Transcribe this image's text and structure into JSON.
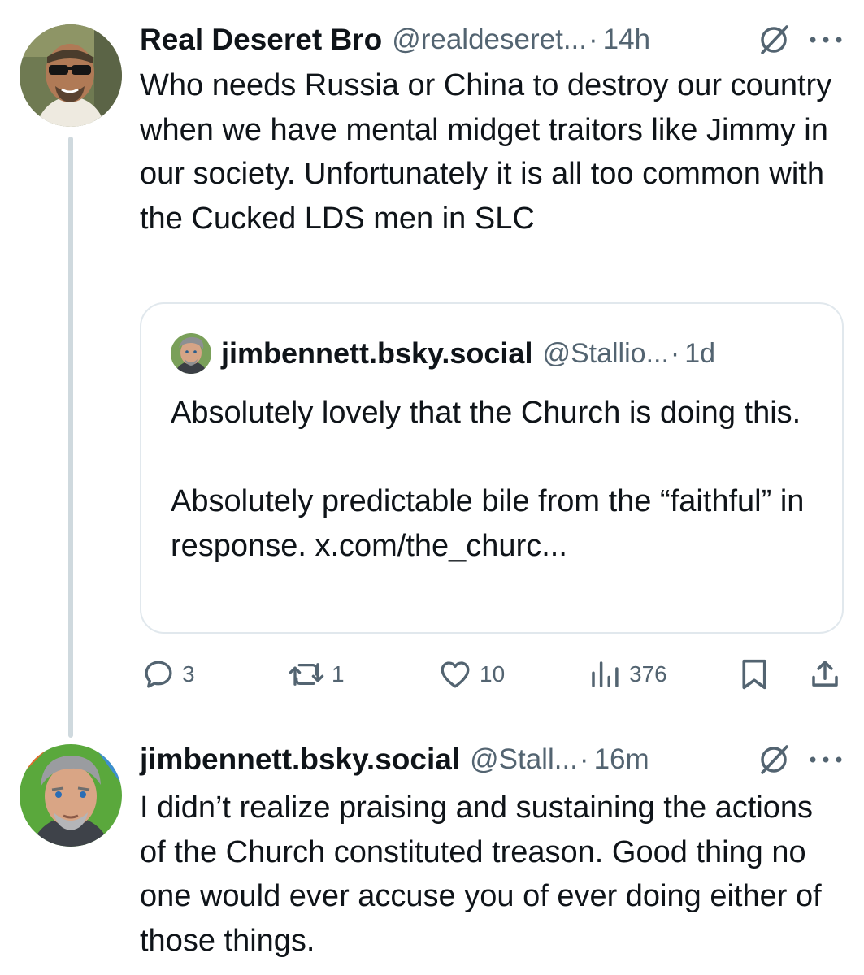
{
  "tweet": {
    "author_name": "Real Deseret Bro",
    "author_handle": "@realdeseret...",
    "separator": "·",
    "time": "14h",
    "icons": [
      "grok-icon",
      "more-icon"
    ],
    "text": "Who needs Russia or China to destroy our country when we have mental midget traitors like Jimmy in our society.  Unfortunately it is all too common with the Cucked LDS men in SLC",
    "quote": {
      "author_name": "jimbennett.bsky.social",
      "author_handle": "@Stallio...",
      "separator": "·",
      "time": "1d",
      "paragraph_1": "Absolutely lovely that the Church is doing this.",
      "paragraph_2": "Absolutely predictable bile from the “faithful” in response. x.com/the_churc..."
    },
    "actions": {
      "replies": "3",
      "reposts": "1",
      "likes": "10",
      "views": "376",
      "icons": [
        "reply-icon",
        "repost-icon",
        "like-icon",
        "views-icon",
        "bookmark-icon",
        "share-icon"
      ]
    }
  },
  "reply": {
    "author_name": "jimbennett.bsky.social",
    "author_handle": "@Stall...",
    "separator": "·",
    "time": "16m",
    "icons": [
      "grok-icon",
      "more-icon"
    ],
    "text": "I didn’t realize praising and sustaining the actions of the Church constituted treason. Good thing no one would ever accuse you of ever doing either of those things."
  },
  "colors": {
    "primary_text": "#0f1419",
    "secondary_text": "#536471",
    "thread_line": "#cfd9de",
    "card_border": "#e1e8ed"
  }
}
